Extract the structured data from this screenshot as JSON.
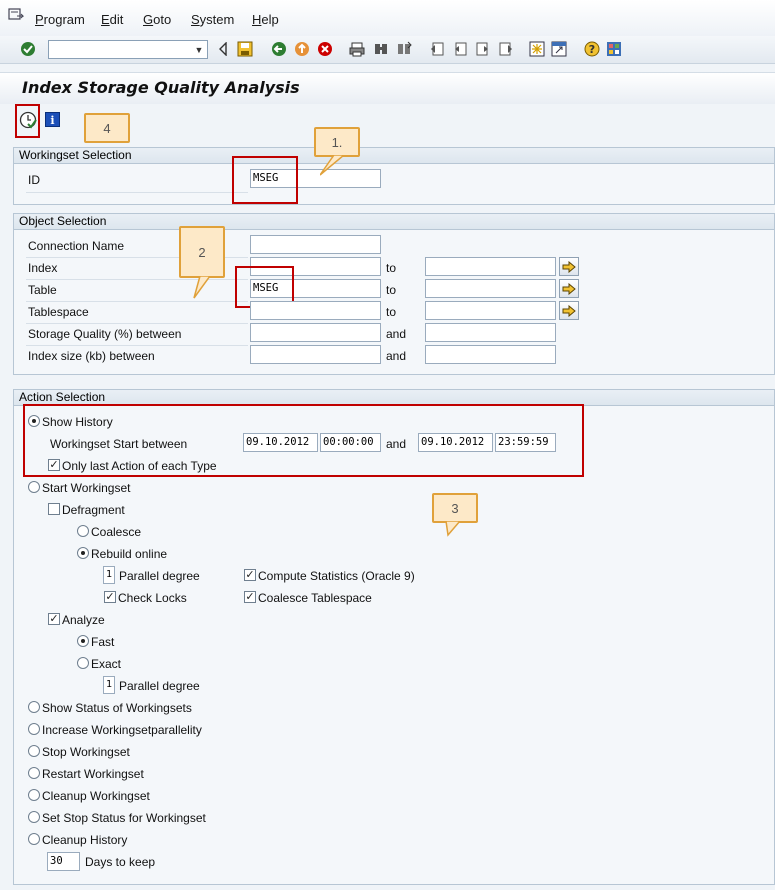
{
  "menu": {
    "items": [
      {
        "first": "P",
        "rest": "rogram"
      },
      {
        "first": "E",
        "rest": "dit"
      },
      {
        "first": "G",
        "rest": "oto"
      },
      {
        "first": "S",
        "rest": "ystem"
      },
      {
        "first": "H",
        "rest": "elp"
      }
    ]
  },
  "toolbar": {
    "command_value": ""
  },
  "page": {
    "title": "Index Storage Quality Analysis"
  },
  "callouts": {
    "c1": "1.",
    "c2": "2",
    "c3": "3",
    "c4": "4"
  },
  "workingset_selection": {
    "title": "Workingset Selection",
    "id_label": "ID",
    "id_value": "MSEG"
  },
  "object_selection": {
    "title": "Object Selection",
    "rows": [
      {
        "label": "Connection Name",
        "from": "",
        "connector": "",
        "to": ""
      },
      {
        "label": "Index",
        "from": "",
        "connector": "to",
        "to": ""
      },
      {
        "label": "Table",
        "from": "MSEG",
        "connector": "to",
        "to": ""
      },
      {
        "label": "Tablespace",
        "from": "",
        "connector": "to",
        "to": ""
      },
      {
        "label": "Storage Quality (%) between",
        "from": "",
        "connector": "and",
        "to": ""
      },
      {
        "label": "Index size (kb) between",
        "from": "",
        "connector": "and",
        "to": ""
      }
    ]
  },
  "action_selection": {
    "title": "Action Selection",
    "show_history": "Show History",
    "ws_start_between": "Workingset Start between",
    "date_from": "09.10.2012",
    "time_from": "00:00:00",
    "and": "and",
    "date_to": "09.10.2012",
    "time_to": "23:59:59",
    "only_last": "Only last Action of each Type",
    "start_workingset": "Start Workingset",
    "defragment": "Defragment",
    "coalesce": "Coalesce",
    "rebuild_online": "Rebuild online",
    "parallel_degree_value": "1",
    "parallel_degree": "Parallel degree",
    "compute_statistics": "Compute Statistics (Oracle 9)",
    "check_locks": "Check Locks",
    "coalesce_tablespace": "Coalesce Tablespace",
    "analyze": "Analyze",
    "fast": "Fast",
    "exact": "Exact",
    "parallel_degree_value_2": "1",
    "parallel_degree_2": "Parallel degree",
    "show_status": "Show Status of Workingsets",
    "increase_parallelity": "Increase Workingsetparallelity",
    "stop_workingset": "Stop Workingset",
    "restart_workingset": "Restart Workingset",
    "cleanup_workingset": "Cleanup Workingset",
    "set_stop_status": "Set Stop Status for Workingset",
    "cleanup_history": "Cleanup History",
    "days_value": "30",
    "days_to_keep": "Days to keep"
  }
}
